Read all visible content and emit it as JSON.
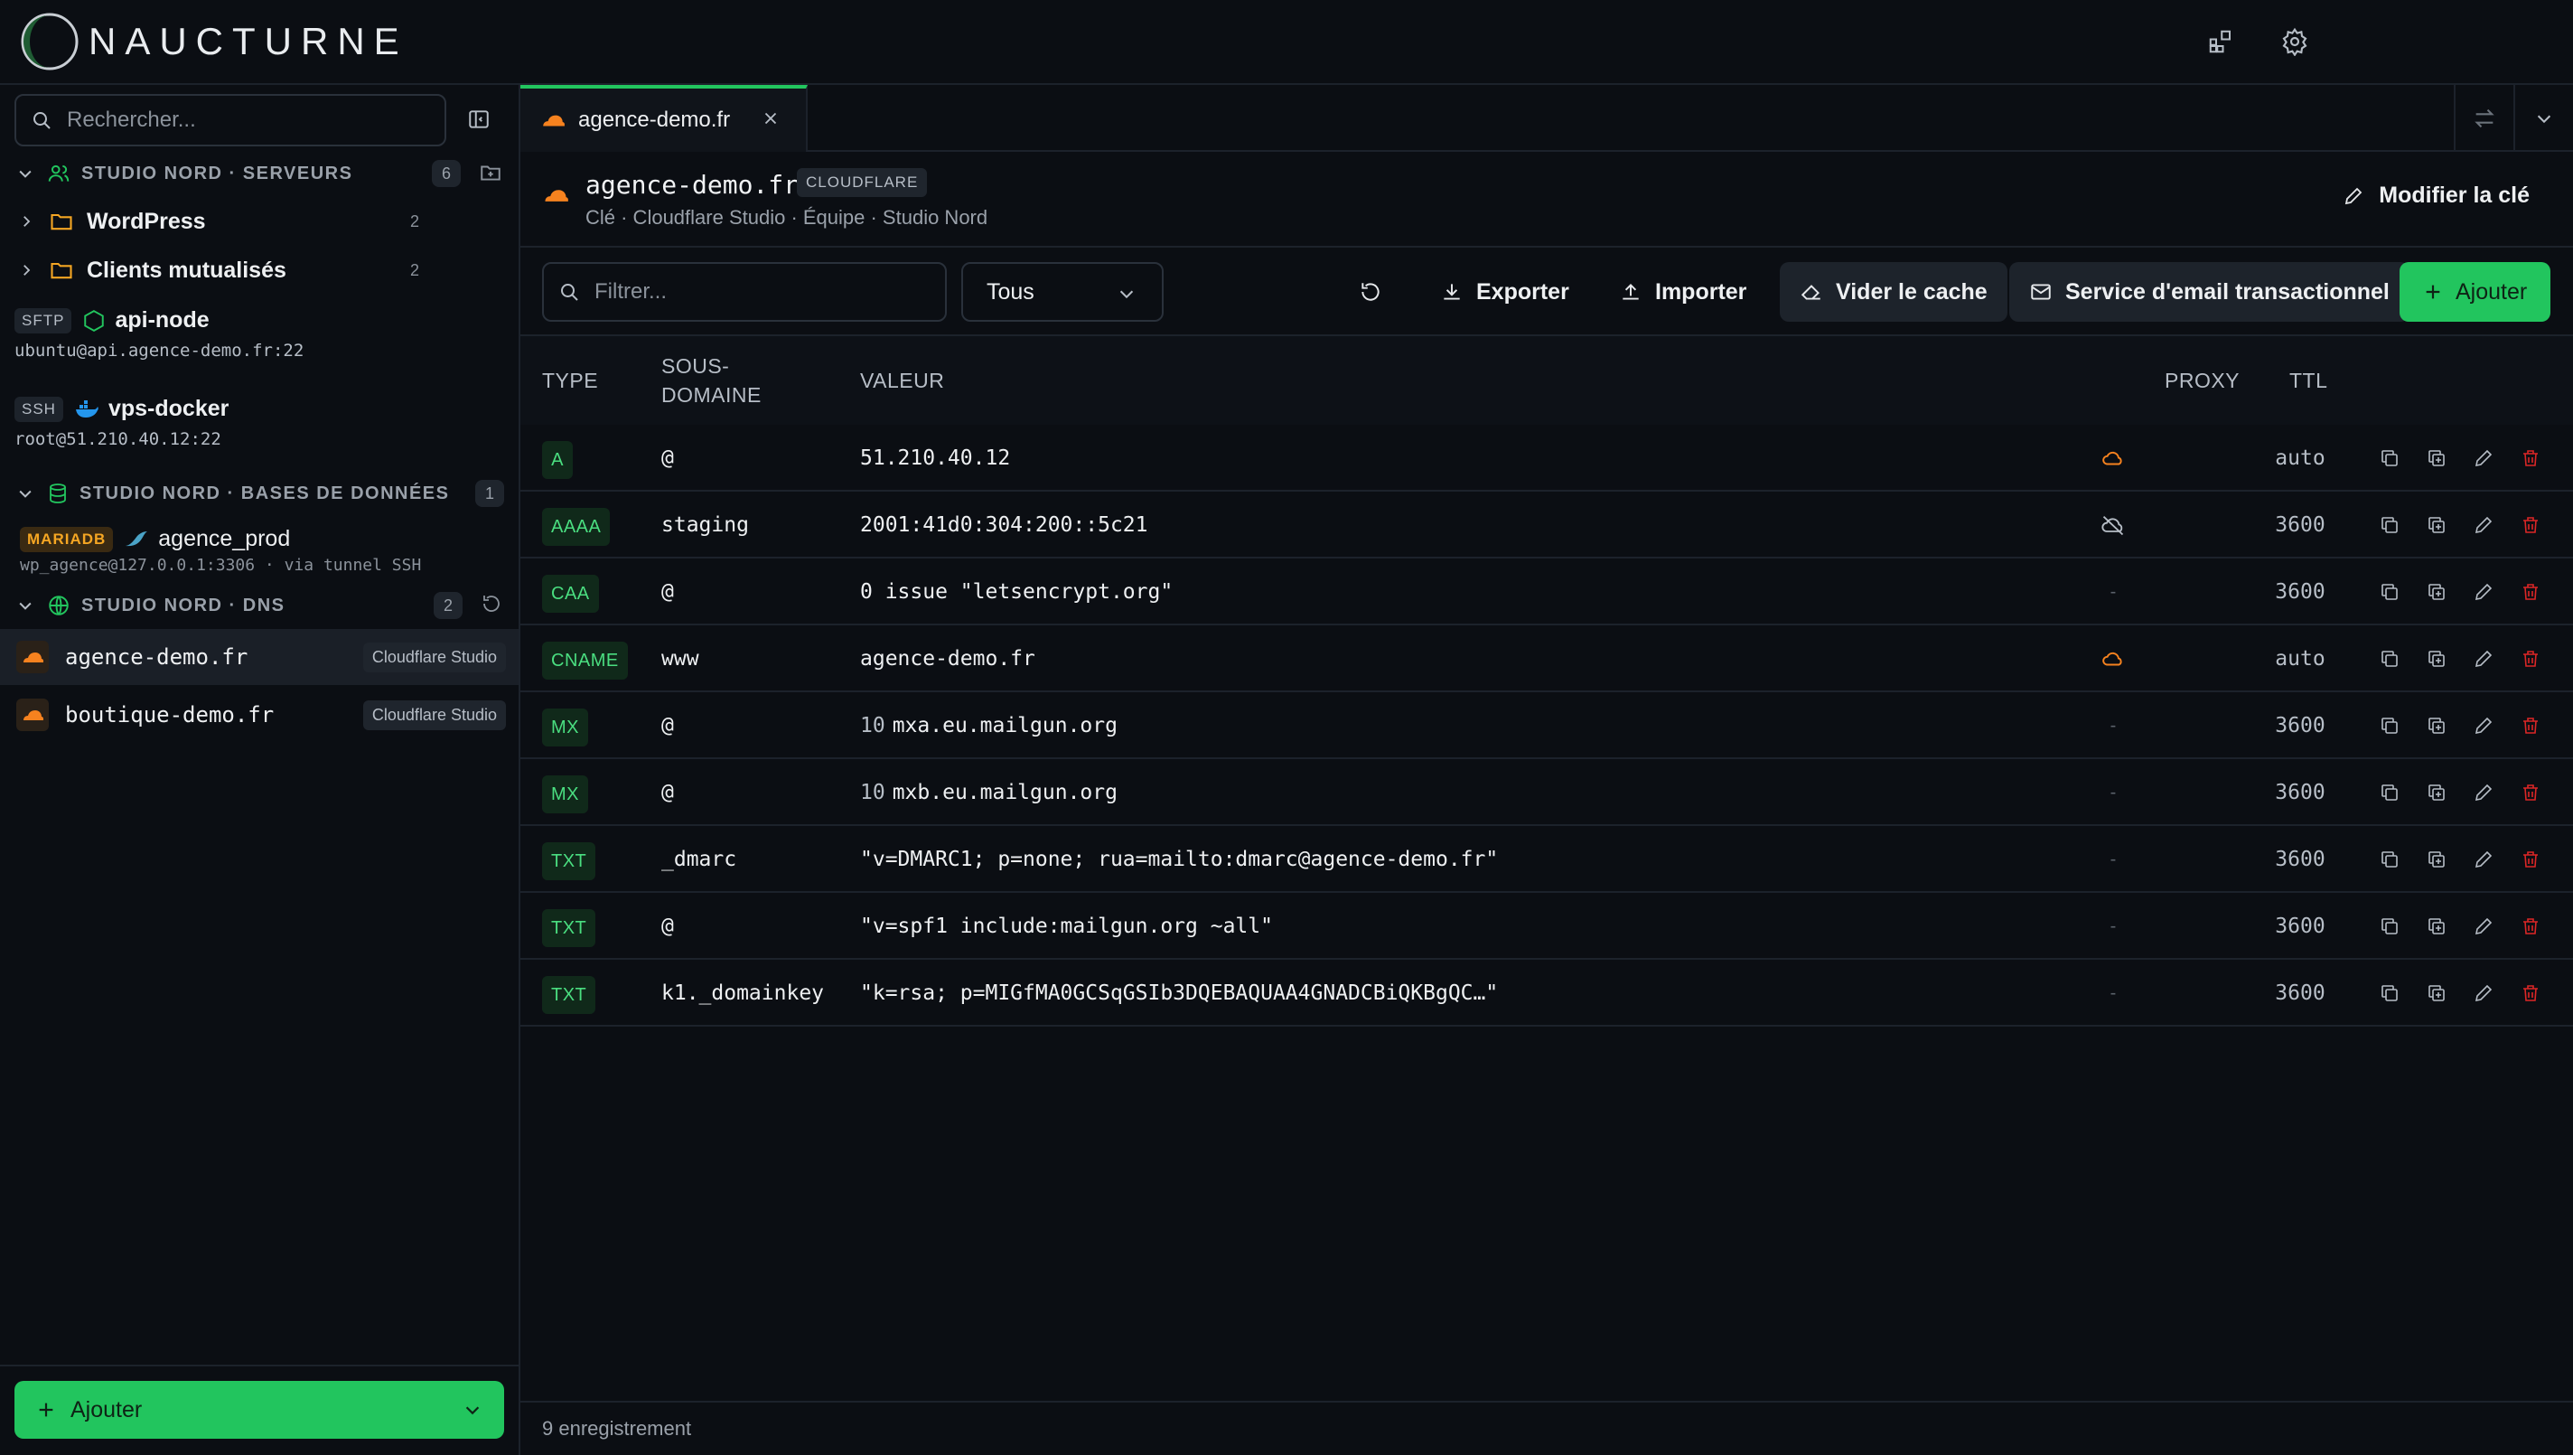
{
  "app": {
    "brand": "NAUCTURNE"
  },
  "sidebar": {
    "search_placeholder": "Rechercher...",
    "groups": [
      {
        "title": "STUDIO NORD · SERVEURS",
        "count": "6"
      },
      {
        "title": "STUDIO NORD · BASES DE DONNÉES",
        "count": "1"
      },
      {
        "title": "STUDIO NORD · DNS",
        "count": "2"
      }
    ],
    "folders": [
      {
        "label": "WordPress",
        "count": "2"
      },
      {
        "label": "Clients mutualisés",
        "count": "2"
      }
    ],
    "connections": [
      {
        "protocol": "SFTP",
        "name": "api-node",
        "sub": "ubuntu@api.agence-demo.fr:22"
      },
      {
        "protocol": "SSH",
        "name": "vps-docker",
        "sub": "root@51.210.40.12:22"
      },
      {
        "protocol": "MARIADB",
        "name": "agence_prod",
        "sub": "wp_agence@127.0.0.1:3306 · via tunnel SSH"
      }
    ],
    "dns_zones": [
      {
        "name": "agence-demo.fr",
        "provider": "Cloudflare Studio"
      },
      {
        "name": "boutique-demo.fr",
        "provider": "Cloudflare Studio"
      }
    ],
    "add_label": "Ajouter"
  },
  "tab": {
    "label": "agence-demo.fr"
  },
  "zone": {
    "title": "agence-demo.fr",
    "tag": "CLOUDFLARE",
    "subtitle": "Clé · Cloudflare Studio · Équipe · Studio Nord",
    "edit_key_label": "Modifier la clé"
  },
  "toolbar": {
    "filter_placeholder": "Filtrer...",
    "select_value": "Tous",
    "export_label": "Exporter",
    "import_label": "Importer",
    "purge_label": "Vider le cache",
    "email_label": "Service d'email transactionnel",
    "add_label": "Ajouter"
  },
  "table": {
    "headers": {
      "type": "TYPE",
      "sub1": "SOUS-",
      "sub2": "DOMAINE",
      "value": "VALEUR",
      "proxy": "PROXY",
      "ttl": "TTL"
    },
    "records": [
      {
        "type": "A",
        "name": "@",
        "prio": "",
        "value": "51.210.40.12",
        "proxy": "on",
        "ttl": "auto"
      },
      {
        "type": "AAAA",
        "name": "staging",
        "prio": "",
        "value": "2001:41d0:304:200::5c21",
        "proxy": "off",
        "ttl": "3600"
      },
      {
        "type": "CAA",
        "name": "@",
        "prio": "",
        "value": "0 issue \"letsencrypt.org\"",
        "proxy": "none",
        "ttl": "3600"
      },
      {
        "type": "CNAME",
        "name": "www",
        "prio": "",
        "value": "agence-demo.fr",
        "proxy": "on",
        "ttl": "auto"
      },
      {
        "type": "MX",
        "name": "@",
        "prio": "10",
        "value": "mxa.eu.mailgun.org",
        "proxy": "none",
        "ttl": "3600"
      },
      {
        "type": "MX",
        "name": "@",
        "prio": "10",
        "value": "mxb.eu.mailgun.org",
        "proxy": "none",
        "ttl": "3600"
      },
      {
        "type": "TXT",
        "name": "_dmarc",
        "prio": "",
        "value": "\"v=DMARC1; p=none; rua=mailto:dmarc@agence-demo.fr\"",
        "proxy": "none",
        "ttl": "3600"
      },
      {
        "type": "TXT",
        "name": "@",
        "prio": "",
        "value": "\"v=spf1 include:mailgun.org ~all\"",
        "proxy": "none",
        "ttl": "3600"
      },
      {
        "type": "TXT",
        "name": "k1._domainkey",
        "prio": "",
        "value": "\"k=rsa; p=MIGfMA0GCSqGSIb3DQEBAQUAA4GNADCBiQKBgQC…\"",
        "proxy": "none",
        "ttl": "3600"
      }
    ],
    "proxy_none_text": "-"
  },
  "footer": {
    "count_text": "9 enregistrement"
  },
  "colors": {
    "accent": "#22c55e",
    "cloudflare": "#f6821f",
    "danger": "#dc2626"
  }
}
